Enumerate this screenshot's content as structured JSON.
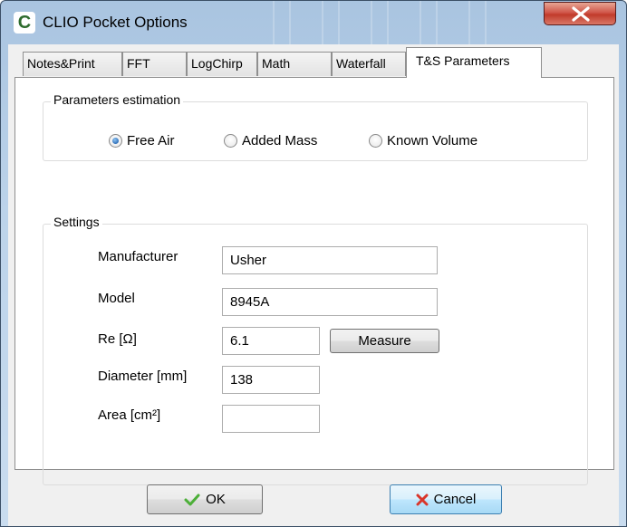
{
  "window": {
    "title": "CLIO Pocket Options",
    "app_icon_letter": "C"
  },
  "tabs": [
    {
      "label": "Notes&Print",
      "active": false
    },
    {
      "label": "FFT",
      "active": false
    },
    {
      "label": "LogChirp",
      "active": false
    },
    {
      "label": "Math",
      "active": false
    },
    {
      "label": "Waterfall",
      "active": false
    },
    {
      "label": "T&S Parameters",
      "active": true
    }
  ],
  "estimation": {
    "group_label": "Parameters estimation",
    "options": [
      {
        "label": "Free Air",
        "checked": true
      },
      {
        "label": "Added Mass",
        "checked": false
      },
      {
        "label": "Known Volume",
        "checked": false
      }
    ]
  },
  "settings": {
    "group_label": "Settings",
    "manufacturer": {
      "label": "Manufacturer",
      "value": "Usher"
    },
    "model": {
      "label": "Model",
      "value": "8945A"
    },
    "re": {
      "label": "Re [Ω]",
      "value": "6.1"
    },
    "diameter": {
      "label": "Diameter [mm]",
      "value": "138"
    },
    "area": {
      "label": "Area [cm²]",
      "value": ""
    },
    "measure_label": "Measure"
  },
  "footer": {
    "ok_label": "OK",
    "cancel_label": "Cancel"
  },
  "colors": {
    "ok_check": "#4caf38",
    "cancel_x": "#d9362b",
    "radio_checked": "#2f6fb8"
  },
  "icons": {
    "close": "close-icon",
    "ok": "checkmark-icon",
    "cancel": "x-icon"
  }
}
